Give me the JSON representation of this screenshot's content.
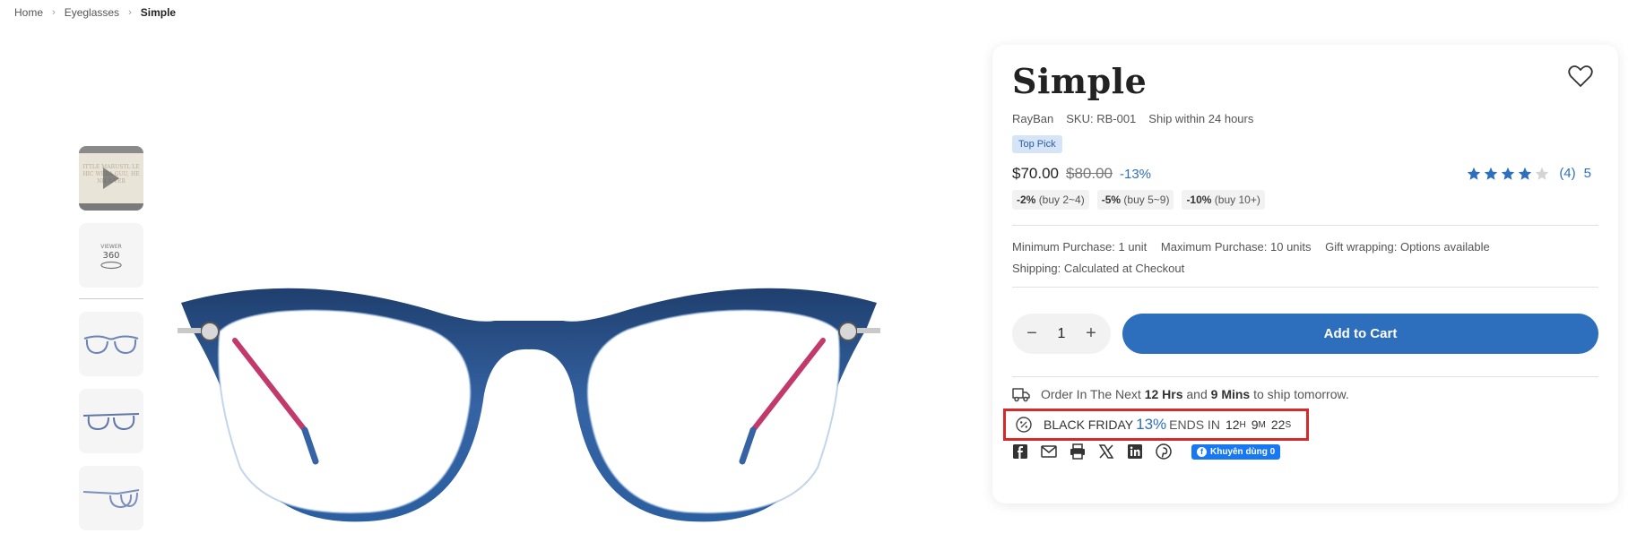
{
  "breadcrumb": {
    "items": [
      "Home",
      "Eyeglasses"
    ],
    "current": "Simple"
  },
  "gallery": {
    "video_text": "ITTLE MARUSTL LE HIC WERA GUU, HE NH A VER",
    "viewer_label": "VIEWER",
    "viewer_degrees": "360"
  },
  "product": {
    "title": "Simple",
    "brand": "RayBan",
    "sku": "SKU: RB-001",
    "ship_note": "Ship within 24 hours",
    "badge": "Top Pick",
    "price": "$70.00",
    "compare_price": "$80.00",
    "discount": "-13%",
    "rating": {
      "stars": 4,
      "max": 5,
      "count": "(4)",
      "score": "5"
    },
    "tiers": [
      {
        "pct": "-2%",
        "range": "(buy 2~4)"
      },
      {
        "pct": "-5%",
        "range": "(buy 5~9)"
      },
      {
        "pct": "-10%",
        "range": "(buy 10+)"
      }
    ],
    "info": [
      "Minimum Purchase: 1 unit",
      "Maximum Purchase: 10 units",
      "Gift wrapping: Options available",
      "Shipping: Calculated at Checkout"
    ]
  },
  "cart": {
    "quantity": "1",
    "minus": "−",
    "plus": "+",
    "add_label": "Add to Cart"
  },
  "shipping_timer": {
    "prefix": "Order In The Next",
    "hours": "12 Hrs",
    "and": "and",
    "mins": "9 Mins",
    "suffix": "to ship tomorrow."
  },
  "sale": {
    "label": "BLACK FRIDAY",
    "percent": "13%",
    "ends": "ENDS IN",
    "h": "12",
    "h_unit": "H",
    "m": "9",
    "m_unit": "M",
    "s": "22",
    "s_unit": "S"
  },
  "share": {
    "fb_like_label": "Khuyên dùng 0"
  },
  "colors": {
    "accent": "#2e6fbd",
    "frame": "#2f5f9a",
    "highlight": "#d32a2a"
  }
}
